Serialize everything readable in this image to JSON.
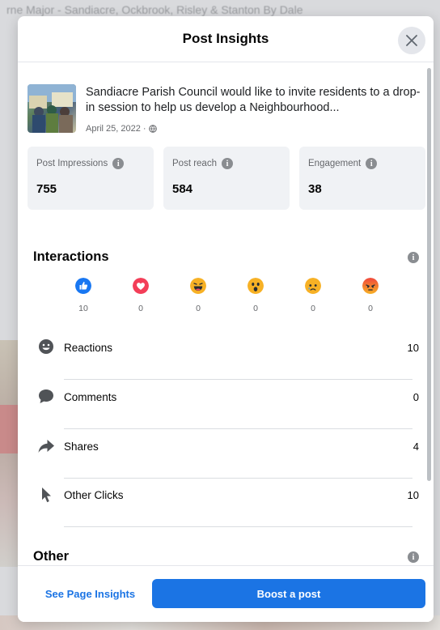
{
  "background": {
    "title": "rne Major - Sandiacre, Ockbrook, Risley & Stanton By Dale"
  },
  "modal": {
    "title": "Post Insights",
    "close_icon": "close-icon"
  },
  "post": {
    "text": "Sandiacre Parish Council would like to invite residents to a drop-in session to help us develop a Neighbourhood...",
    "date": "April 25, 2022 ·",
    "privacy_icon": "globe-icon"
  },
  "metrics": [
    {
      "label": "Post Impressions",
      "value": "755"
    },
    {
      "label": "Post reach",
      "value": "584"
    },
    {
      "label": "Engagement",
      "value": "38"
    }
  ],
  "interactions": {
    "title": "Interactions",
    "reactions": [
      {
        "icon": "like-icon",
        "count": "10",
        "color": "#1877f2"
      },
      {
        "icon": "love-icon",
        "count": "0",
        "color": "#f33e58"
      },
      {
        "icon": "haha-icon",
        "count": "0",
        "color": "#f7b125"
      },
      {
        "icon": "wow-icon",
        "count": "0",
        "color": "#f7b125"
      },
      {
        "icon": "sad-icon",
        "count": "0",
        "color": "#f7b125"
      },
      {
        "icon": "angry-icon",
        "count": "0",
        "color": "#e9710f"
      }
    ],
    "stats": [
      {
        "icon": "smiley-icon",
        "label": "Reactions",
        "value": "10"
      },
      {
        "icon": "comment-icon",
        "label": "Comments",
        "value": "0"
      },
      {
        "icon": "share-icon",
        "label": "Shares",
        "value": "4"
      },
      {
        "icon": "cursor-icon",
        "label": "Other Clicks",
        "value": "10"
      }
    ]
  },
  "other": {
    "title": "Other"
  },
  "footer": {
    "see_insights": "See Page Insights",
    "boost": "Boost a post"
  },
  "colors": {
    "accent": "#1b74e4",
    "card_bg": "#f0f2f5",
    "text_secondary": "#65676b"
  }
}
